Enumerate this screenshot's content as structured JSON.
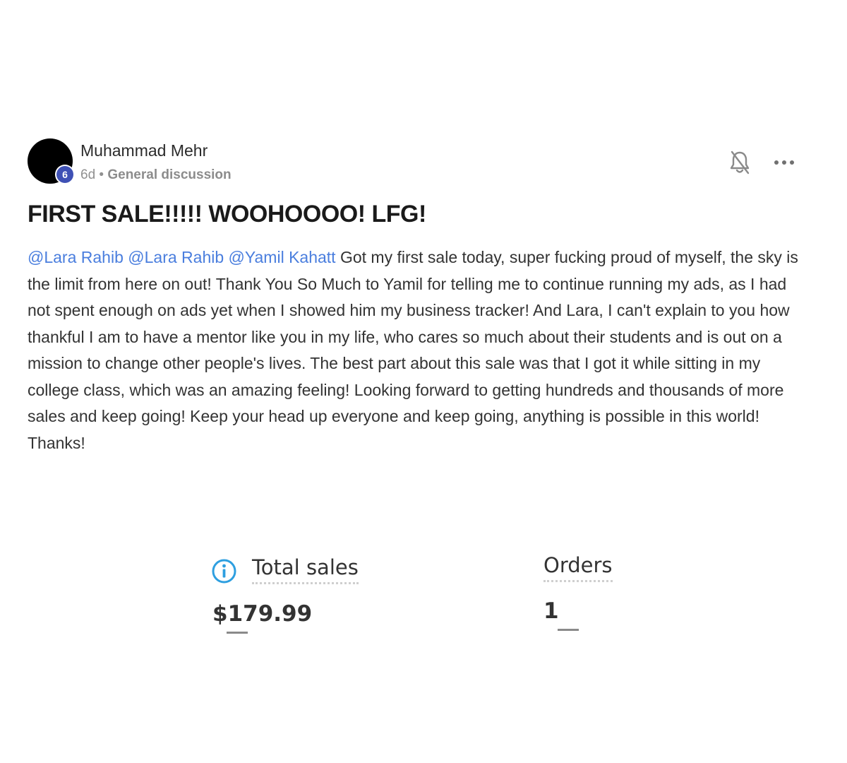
{
  "post": {
    "author": {
      "name": "Muhammad Mehr",
      "level": "6"
    },
    "meta": {
      "time_ago": "6d",
      "separator": "•",
      "category": "General discussion"
    },
    "icons": {
      "notifications": "bell-off-icon",
      "more": "more-horizontal-icon"
    },
    "title": "FIRST SALE!!!!! WOOHOOOO! LFG!",
    "mentions": [
      "@Lara Rahib",
      "@Lara Rahib",
      "@Yamil Kahatt"
    ],
    "body": "Got my first sale today, super fucking proud of myself, the sky is the limit from here on out! Thank You So Much to Yamil for telling me to continue running my ads, as I had not spent enough on ads yet when I showed him my business tracker! And Lara, I can't explain to you how thankful I am to have a mentor like you in my life, who cares so much about their students and is out on a mission to change other people's lives. The best part about this sale was that I got it while sitting in my college class, which was an amazing feeling! Looking forward to getting hundreds and thousands of more sales and keep going! Keep your head up everyone and keep going, anything is possible in this world! Thanks!",
    "colors": {
      "mention": "#4a7ede",
      "level_badge": "#3f51b5",
      "info_icon": "#2e9fe0"
    }
  },
  "screenshot": {
    "total_sales": {
      "label": "Total sales",
      "value": "$179.99",
      "icon": "info-icon"
    },
    "orders": {
      "label": "Orders",
      "value": "1"
    }
  }
}
